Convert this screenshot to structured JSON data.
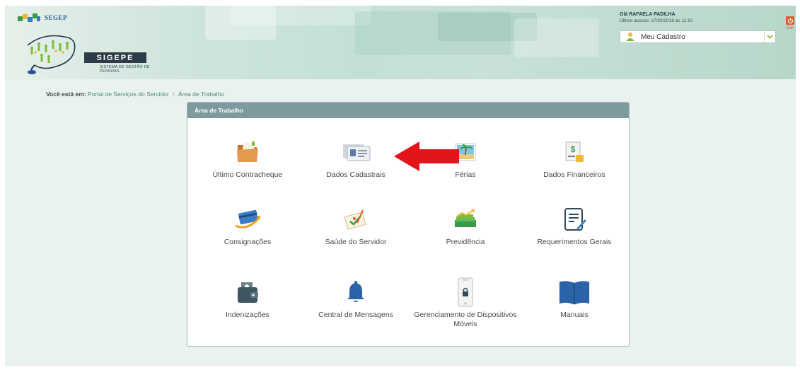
{
  "header": {
    "segep_text": "SEGEP",
    "logo_subtitle": "SISTEMA DE GESTÃO DE PESSOAS",
    "logo_title": "SIGEPE",
    "greeting": "Olá RAFAELA PADILHA",
    "last_access": "Último acesso: 27/02/2019 às 11:10",
    "cadastro_select": "Meu Cadastro",
    "exit_label": "Sair"
  },
  "breadcrumb": {
    "prefix": "Você está em:",
    "items": [
      "Portal de Serviços do Servidor",
      "Área de Trabalho"
    ],
    "separator": "/"
  },
  "panel": {
    "title": "Área de Trabalho",
    "tiles": [
      {
        "label": "Último Contracheque",
        "icon": "folder-icon"
      },
      {
        "label": "Dados Cadastrais",
        "icon": "id-cards-icon"
      },
      {
        "label": "Férias",
        "icon": "beach-photo-icon"
      },
      {
        "label": "Dados Financeiros",
        "icon": "money-document-icon"
      },
      {
        "label": "Consignações",
        "icon": "card-swoosh-icon"
      },
      {
        "label": "Saúde do Servidor",
        "icon": "health-checklist-icon"
      },
      {
        "label": "Previdência",
        "icon": "money-growth-icon"
      },
      {
        "label": "Requerimentos Gerais",
        "icon": "document-edit-icon"
      },
      {
        "label": "Indenizações",
        "icon": "wallet-icon"
      },
      {
        "label": "Central de Mensagens",
        "icon": "bell-icon"
      },
      {
        "label": "Gerenciamento de Dispositivos Móveis",
        "icon": "mobile-lock-icon"
      },
      {
        "label": "Manuais",
        "icon": "book-icon"
      }
    ]
  },
  "colors": {
    "panel_header": "#7f9a9e",
    "accent_green": "#4a8a78",
    "exit_orange": "#e25a2c",
    "arrow_red": "#e3151b"
  }
}
